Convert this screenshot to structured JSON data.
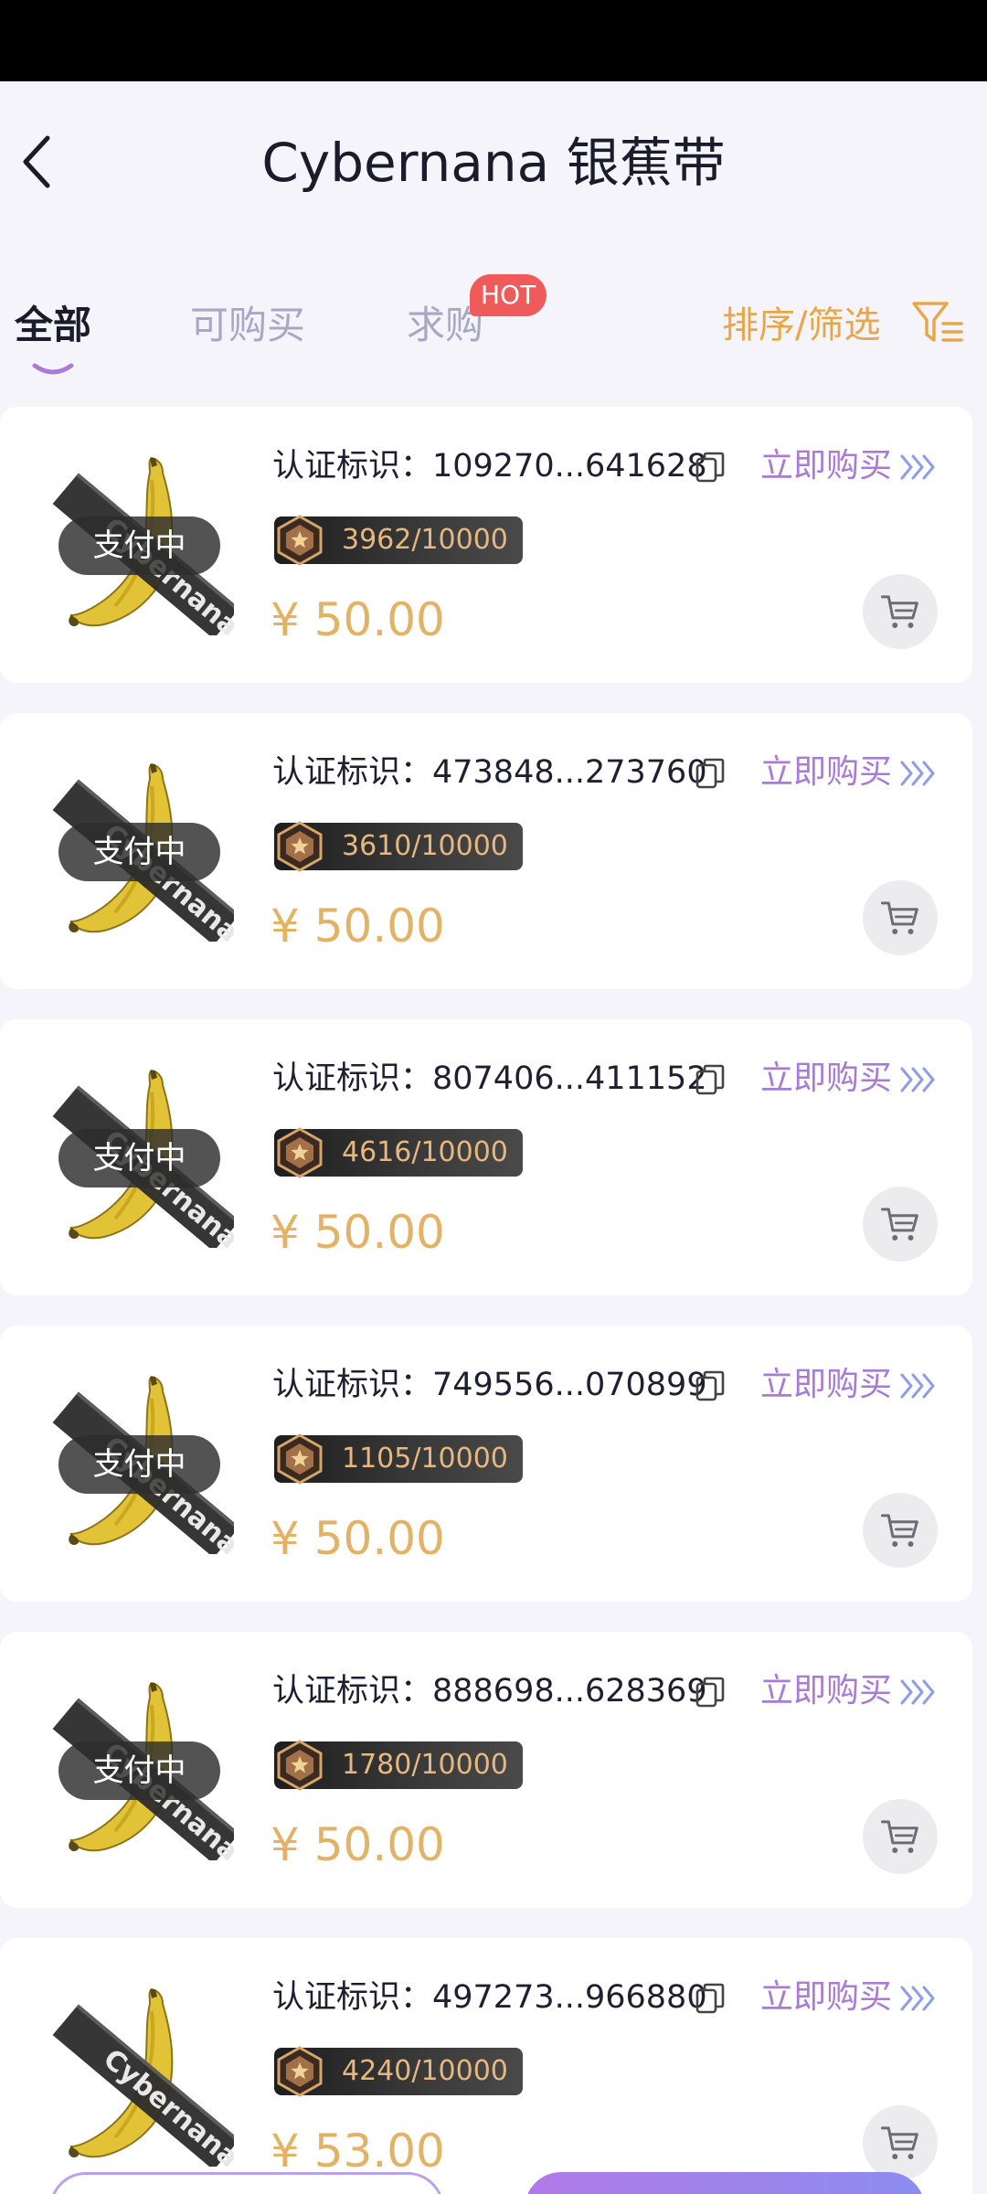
{
  "header": {
    "title": "Cybernana 银蕉带"
  },
  "tabs": [
    {
      "label": "全部",
      "active": true
    },
    {
      "label": "可购买",
      "active": false
    },
    {
      "label": "求购",
      "active": false,
      "badge": "HOT"
    }
  ],
  "sort_filter_label": "排序/筛选",
  "colors": {
    "accent_purple": "#a97ad6",
    "price_gold": "#e3b265",
    "sort_orange": "#e8a648",
    "hot_red": "#ef5b5b"
  },
  "items": [
    {
      "status": "支付中",
      "cert": "认证标识：109270...641628",
      "buy": "立即购买",
      "edition": "3962/10000",
      "price": "¥ 50.00"
    },
    {
      "status": "支付中",
      "cert": "认证标识：473848...273760",
      "buy": "立即购买",
      "edition": "3610/10000",
      "price": "¥ 50.00"
    },
    {
      "status": "支付中",
      "cert": "认证标识：807406...411152",
      "buy": "立即购买",
      "edition": "4616/10000",
      "price": "¥ 50.00"
    },
    {
      "status": "支付中",
      "cert": "认证标识：749556...070899",
      "buy": "立即购买",
      "edition": "1105/10000",
      "price": "¥ 50.00"
    },
    {
      "status": "支付中",
      "cert": "认证标识：888698...628369",
      "buy": "立即购买",
      "edition": "1780/10000",
      "price": "¥ 50.00"
    },
    {
      "status": "",
      "cert": "认证标识：497273...966880",
      "buy": "立即购买",
      "edition": "4240/10000",
      "price": "¥ 53.00"
    }
  ],
  "icons": {
    "back": "chevron-left-icon",
    "filter": "filter-icon",
    "copy": "copy-icon",
    "more": "triple-chevron-right-icon",
    "edition": "hexagon-star-icon",
    "cart": "cart-icon"
  }
}
